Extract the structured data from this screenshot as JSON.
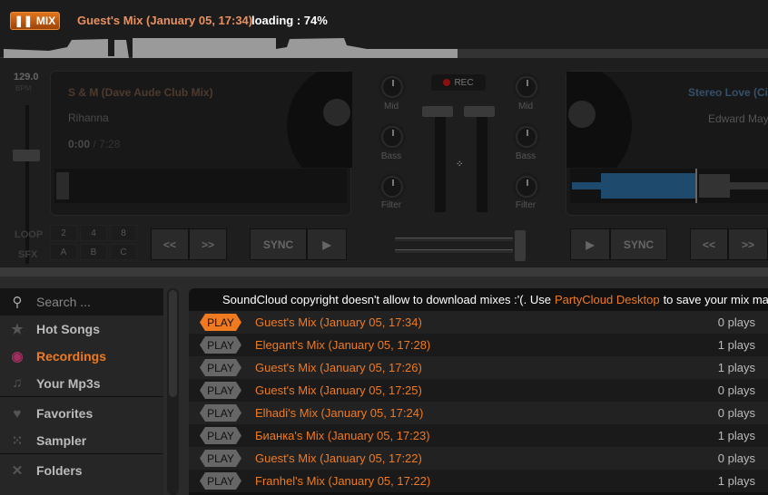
{
  "header": {
    "mix_button": "MIX",
    "title": "Guest's Mix (January 05, 17:34)",
    "loading": "loading : 74%"
  },
  "deck_left": {
    "bpm": "129.0",
    "bpm_label": "BPM",
    "title": "S & M (Dave Aude Club Mix)",
    "artist": "Rihanna",
    "time": "0:00",
    "duration": "/ 7:28",
    "loop_label": "LOOP",
    "sfx_label": "SFX",
    "loop_pads": [
      "2",
      "4",
      "8"
    ],
    "sfx_pads": [
      "A",
      "B",
      "C"
    ],
    "sync": "SYNC"
  },
  "mixer": {
    "rec": "REC",
    "knobs": [
      "Mid",
      "Bass",
      "Filter"
    ]
  },
  "deck_right": {
    "title": "Stereo Love (Ci",
    "artist": "Edward May",
    "sync": "SYNC"
  },
  "sidebar": {
    "search_placeholder": "Search ...",
    "items": [
      {
        "label": "Hot Songs",
        "icon": "star"
      },
      {
        "label": "Recordings",
        "icon": "record",
        "active": true
      },
      {
        "label": "Your Mp3s",
        "icon": "music-note"
      },
      {
        "label": "Favorites",
        "icon": "heart"
      },
      {
        "label": "Sampler",
        "icon": "grid"
      },
      {
        "label": "Folders",
        "icon": "shuffle"
      }
    ]
  },
  "list": {
    "notice_pre": "SoundCloud copyright doesn't allow to download mixes :'(. Use ",
    "notice_link": "PartyCloud Desktop",
    "notice_post": " to save your mix ma",
    "play_label": "PLAY",
    "rows": [
      {
        "title": "Guest's Mix (January 05, 17:34)",
        "plays": "0 plays",
        "active": true
      },
      {
        "title": "Elegant's Mix (January 05, 17:28)",
        "plays": "1 plays"
      },
      {
        "title": "Guest's Mix (January 05, 17:26)",
        "plays": "1 plays"
      },
      {
        "title": "Guest's Mix (January 05, 17:25)",
        "plays": "0 plays"
      },
      {
        "title": "Elhadi's Mix (January 05, 17:24)",
        "plays": "0 plays"
      },
      {
        "title": "Бианка's Mix (January 05, 17:23)",
        "plays": "1 plays"
      },
      {
        "title": "Guest's Mix (January 05, 17:22)",
        "plays": "0 plays"
      },
      {
        "title": "Franhel's Mix (January 05, 17:22)",
        "plays": "1 plays"
      }
    ]
  },
  "colors": {
    "accent": "#f07a20",
    "deck_right_wave": "#1e4a6e"
  }
}
